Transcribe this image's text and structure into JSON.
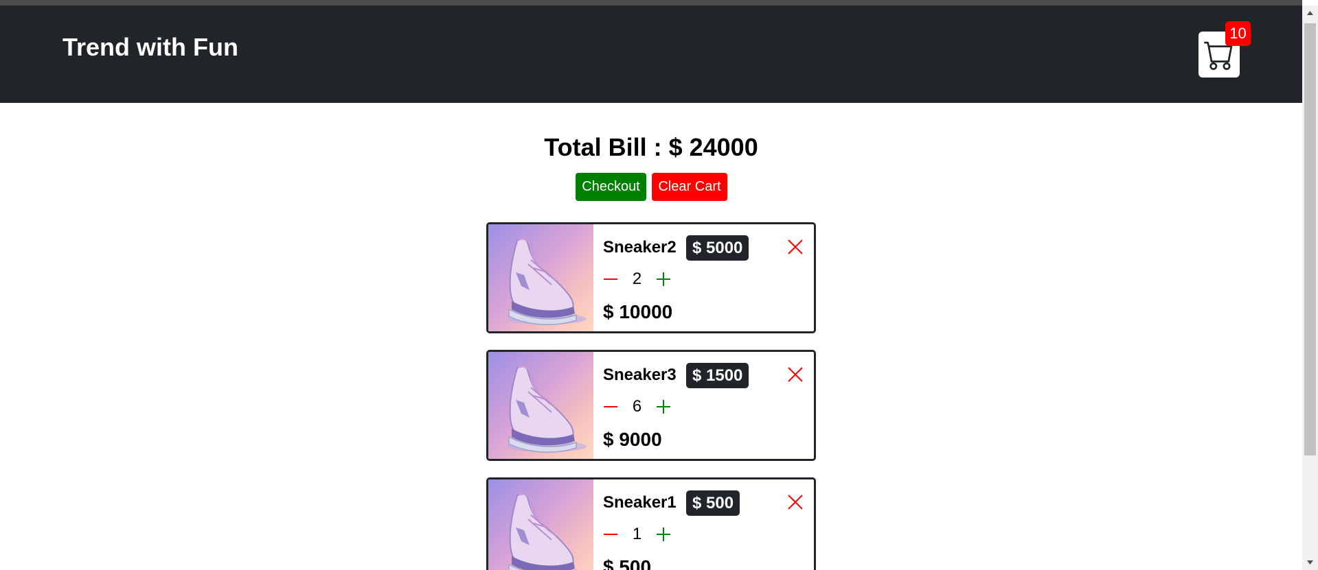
{
  "header": {
    "brand": "Trend with Fun",
    "cart_count": "10",
    "cart_icon": "shopping-cart-icon",
    "background": "#212529"
  },
  "summary": {
    "total_label": "Total Bill : $ 24000"
  },
  "actions": {
    "checkout_label": "Checkout",
    "clear_label": "Clear Cart",
    "checkout_color": "#008000",
    "clear_color": "#ff0000"
  },
  "cart_items": [
    {
      "name": "Sneaker2",
      "price": "$ 5000",
      "quantity": "2",
      "subtotal": "$ 10000"
    },
    {
      "name": "Sneaker3",
      "price": "$ 1500",
      "quantity": "6",
      "subtotal": "$ 9000"
    },
    {
      "name": "Sneaker1",
      "price": "$ 500",
      "quantity": "1",
      "subtotal": "$ 500"
    }
  ],
  "icons": {
    "remove": "close-icon",
    "decrement": "minus-icon",
    "increment": "plus-icon"
  }
}
